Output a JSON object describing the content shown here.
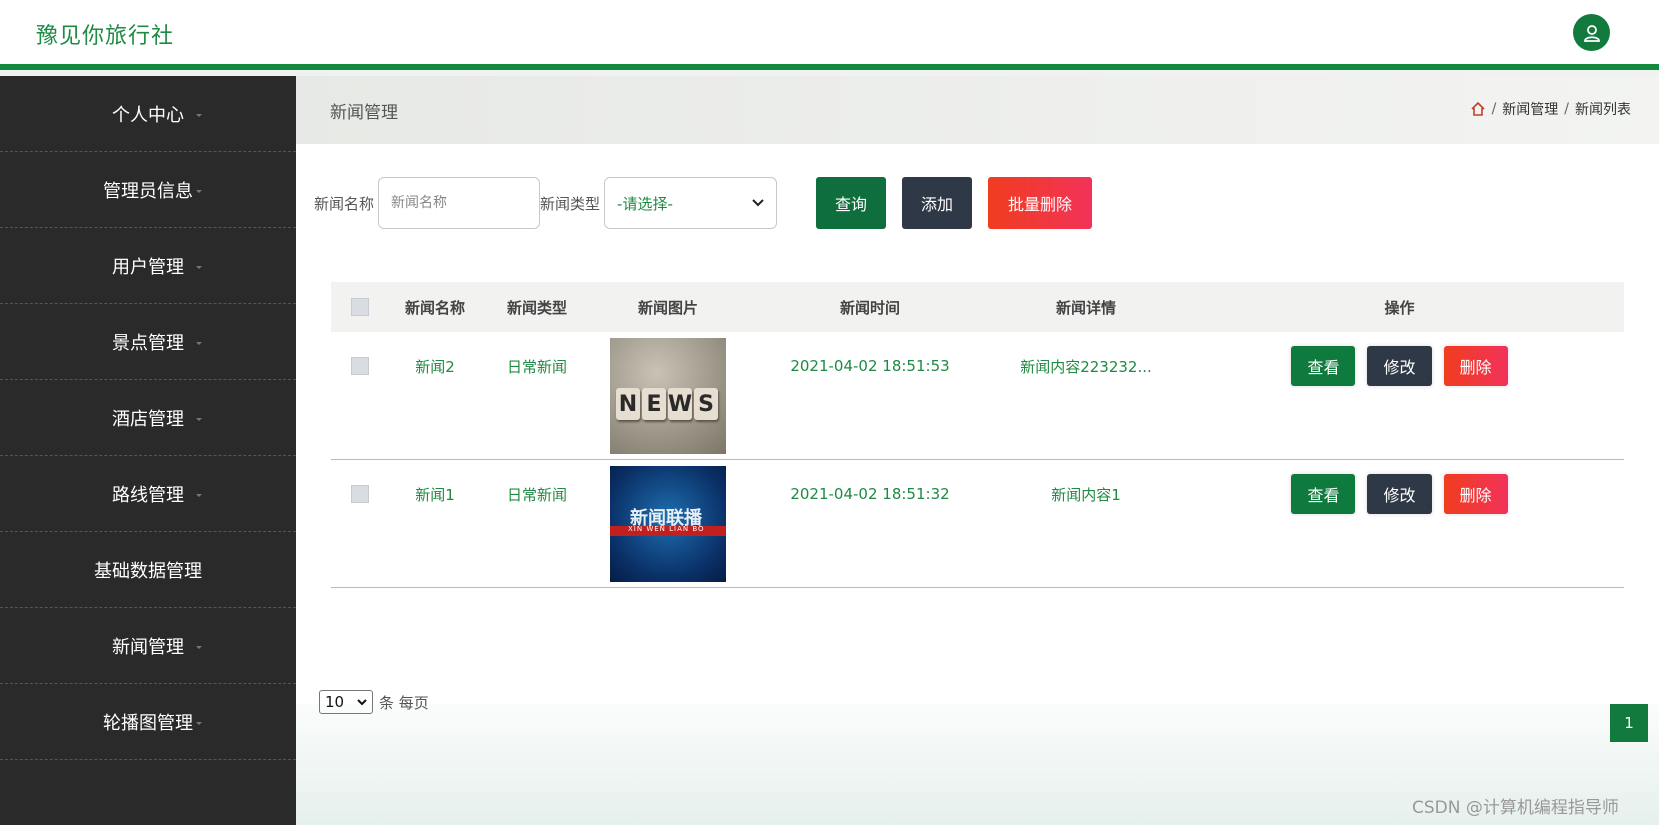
{
  "header": {
    "brand": "豫见你旅行社",
    "avatar_icon": "user-icon"
  },
  "sidebar": {
    "items": [
      {
        "label": "个人中心"
      },
      {
        "label": "管理员信息"
      },
      {
        "label": "用户管理"
      },
      {
        "label": "景点管理"
      },
      {
        "label": "酒店管理"
      },
      {
        "label": "路线管理"
      },
      {
        "label": "基础数据管理"
      },
      {
        "label": "新闻管理"
      },
      {
        "label": "轮播图管理"
      }
    ]
  },
  "breadcrumb": {
    "title": "新闻管理",
    "home_icon": "home-icon",
    "sep": "/",
    "level1": "新闻管理",
    "level2": "新闻列表"
  },
  "search": {
    "name_label": "新闻名称",
    "name_placeholder": "新闻名称",
    "type_label": "新闻类型",
    "type_selected": "-请选择-",
    "query_btn": "查询",
    "add_btn": "添加",
    "batch_delete_btn": "批量删除"
  },
  "table": {
    "headers": {
      "name": "新闻名称",
      "type": "新闻类型",
      "image": "新闻图片",
      "time": "新闻时间",
      "detail": "新闻详情",
      "ops": "操作"
    },
    "rows": [
      {
        "name": "新闻2",
        "type": "日常新闻",
        "time": "2021-04-02 18:51:53",
        "detail": "新闻内容223232...",
        "image_text": "NEWS"
      },
      {
        "name": "新闻1",
        "type": "日常新闻",
        "time": "2021-04-02 18:51:32",
        "detail": "新闻内容1",
        "image_text": "新闻联播",
        "image_subtext": "XIN WEN LIAN BO"
      }
    ],
    "view_label": "查看",
    "edit_label": "修改",
    "delete_label": "删除"
  },
  "pagination": {
    "page_size": "10",
    "page_size_suffix": "条 每页",
    "current_page": "1"
  },
  "watermark": "CSDN @计算机编程指导师",
  "colors": {
    "primary": "#127a3c",
    "dark": "#2f3846",
    "danger": "#f03d1f",
    "sidebar": "#292a29"
  }
}
